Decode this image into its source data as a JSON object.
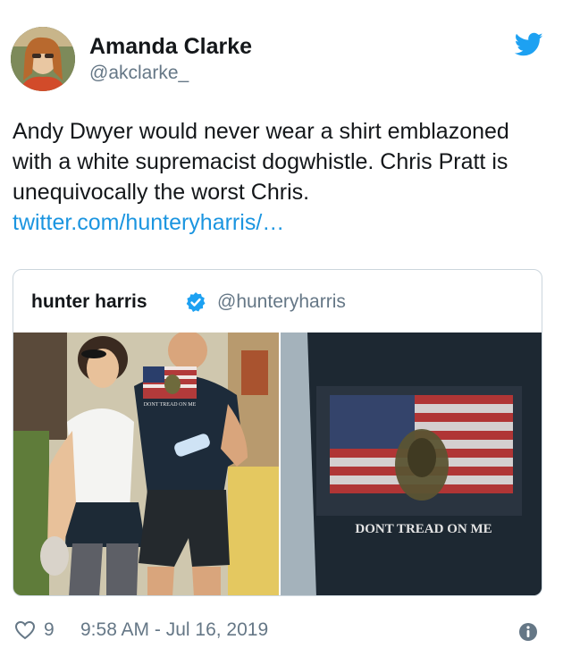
{
  "author": {
    "name": "Amanda Clarke",
    "handle": "@akclarke_"
  },
  "tweet": {
    "text": "Andy Dwyer would never wear a shirt emblazoned with a white supremacist dogwhistle. Chris Pratt is unequivocally the worst Chris. ",
    "link_text": "twitter.com/hunteryharris/…"
  },
  "quoted_tweet": {
    "name": "hunter harris",
    "handle": "@hunteryharris",
    "photo_left_shirt_text": "DONT TREAD ON ME",
    "photo_right_shirt_text": "DONT TREAD ON ME"
  },
  "footer": {
    "likes": "9",
    "timestamp": "9:58 AM - Jul 16, 2019"
  },
  "colors": {
    "link": "#1b95e0",
    "secondary_text": "#657786",
    "twitter_blue": "#1da1f2",
    "border": "#ccd6dd"
  },
  "icons": [
    "twitter-bird-icon",
    "verified-badge-icon",
    "heart-icon",
    "info-icon"
  ]
}
